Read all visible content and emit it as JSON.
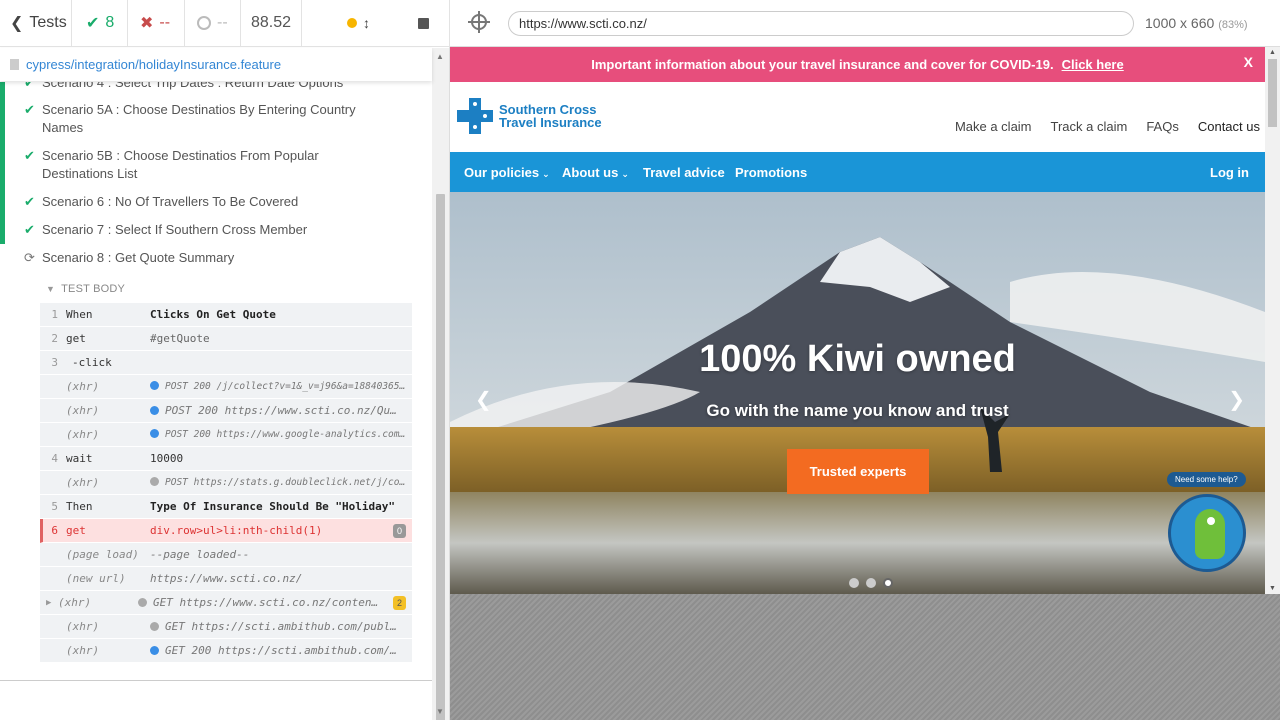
{
  "stats": {
    "tests_label": "Tests",
    "passed": "8",
    "failed": "--",
    "pending": "--",
    "duration": "88.52"
  },
  "spec": {
    "path": "cypress/integration/holidayInsurance.feature"
  },
  "scenarios": [
    {
      "label": "Scenario 4 : Select Trip Dates : Return Date Options",
      "state": "passed"
    },
    {
      "label": "Scenario 5A : Choose Destinatios By Entering Country Names",
      "state": "passed"
    },
    {
      "label": "Scenario 5B : Choose Destinatios From Popular Destinations List",
      "state": "passed"
    },
    {
      "label": "Scenario 6 : No Of Travellers To Be Covered",
      "state": "passed"
    },
    {
      "label": "Scenario 7 : Select If Southern Cross Member",
      "state": "passed"
    },
    {
      "label": "Scenario 8 : Get Quote Summary",
      "state": "running"
    }
  ],
  "test_body": {
    "label": "TEST BODY",
    "commands": [
      {
        "num": "1",
        "name": "When",
        "msg": "Clicks On Get Quote"
      },
      {
        "num": "2",
        "name": "get",
        "msg": "#getQuote"
      },
      {
        "num": "3",
        "name": "-click",
        "msg": ""
      },
      {
        "num": "",
        "name": "(xhr)",
        "msg": "POST 200 /j/collect?v=1&_v=j96&a=18840365…"
      },
      {
        "num": "",
        "name": "(xhr)",
        "msg": "POST 200 https://www.scti.co.nz/Qu…"
      },
      {
        "num": "",
        "name": "(xhr)",
        "msg": "POST 200 https://www.google-analytics.com…"
      },
      {
        "num": "4",
        "name": "wait",
        "msg": "10000"
      },
      {
        "num": "",
        "name": "(xhr)",
        "msg": "POST https://stats.g.doubleclick.net/j/co…"
      },
      {
        "num": "5",
        "name": "Then",
        "msg": "Type Of Insurance Should Be \"Holiday\""
      },
      {
        "num": "6",
        "name": "get",
        "msg": "div.row>ul>li:nth-child(1)",
        "badge": "0"
      },
      {
        "num": "",
        "name": "(page load)",
        "msg": "--page loaded--"
      },
      {
        "num": "",
        "name": "(new url)",
        "msg": "https://www.scti.co.nz/"
      },
      {
        "num": "",
        "name": "(xhr)",
        "msg": "GET https://www.scti.co.nz/conten…",
        "badge": "2"
      },
      {
        "num": "",
        "name": "(xhr)",
        "msg": "GET https://scti.ambithub.com/publ…"
      },
      {
        "num": "",
        "name": "(xhr)",
        "msg": "GET 200 https://scti.ambithub.com/…"
      }
    ]
  },
  "aut": {
    "url": "https://www.scti.co.nz/",
    "viewport": "1000 x 660",
    "scale": "(83%)"
  },
  "site": {
    "covid_text": "Important information about your travel insurance and cover for COVID-19.",
    "covid_link": "Click here",
    "close": "X",
    "logo_line1": "Southern Cross",
    "logo_line2": "Travel Insurance",
    "top_links": [
      "Make a claim",
      "Track a claim",
      "FAQs",
      "Contact us"
    ],
    "nav": [
      "Our policies",
      "About us",
      "Travel advice",
      "Promotions"
    ],
    "login": "Log in",
    "hero_title": "100% Kiwi owned",
    "hero_sub": "Go with the name you know and trust",
    "hero_button": "Trusted experts",
    "help": "Need some help?"
  },
  "colors": {
    "pass": "#1aac6b",
    "fail": "#c74b4b",
    "covid_banner": "#e74e7c",
    "nav_blue": "#1a95d7",
    "cta_orange": "#f36b21"
  }
}
